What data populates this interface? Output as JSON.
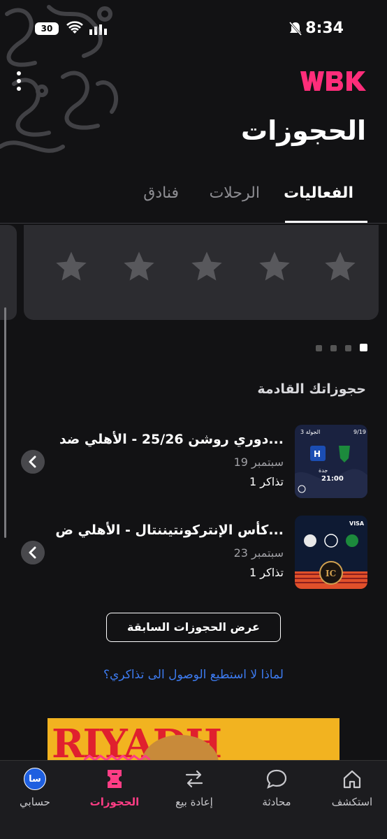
{
  "status_bar": {
    "battery": "30",
    "time": "8:34"
  },
  "header": {
    "logo_text": "WBK",
    "title": "الحجوزات"
  },
  "tabs": [
    {
      "label": "الفعاليات",
      "active": true
    },
    {
      "label": "الرحلات",
      "active": false
    },
    {
      "label": "فنادق",
      "active": false
    }
  ],
  "rating": {
    "stars": 5,
    "filled": 0
  },
  "carousel": {
    "pages": 4,
    "active_index": 0
  },
  "upcoming": {
    "title": "حجوزاتك القادمة",
    "bookings": [
      {
        "title": "دوري روشن 25/26 - الأهلي ضد...",
        "date": "19 سبتمبر",
        "tickets": "1 تذاكر",
        "thumb": {
          "round": "الجولة 3",
          "date": "9/19",
          "home": "الأهلي",
          "away": "الهلال",
          "city": "جدة",
          "time": "21:00"
        }
      },
      {
        "title": "كأس الإنتركونتيننتال - الأهلي ض...",
        "date": "23 سبتمبر",
        "tickets": "1 تذاكر",
        "thumb": {
          "sponsor": "VISA"
        }
      }
    ]
  },
  "past_button": "عرض الحجوزات السابقة",
  "help_link": "لماذا لا استطيع الوصول الى تذاكري؟",
  "banner_text": "RIYADH",
  "nav": [
    {
      "label": "استكشف",
      "icon": "home-icon"
    },
    {
      "label": "محادثة",
      "icon": "chat-icon"
    },
    {
      "label": "إعادة بيع",
      "icon": "resale-icon"
    },
    {
      "label": "الحجوزات",
      "icon": "ticket-icon",
      "active": true
    },
    {
      "label": "حسابي",
      "icon": "avatar",
      "avatar_text": "سا"
    }
  ],
  "colors": {
    "accent": "#ff3d85",
    "link": "#3d7bf0",
    "background": "#121214"
  }
}
